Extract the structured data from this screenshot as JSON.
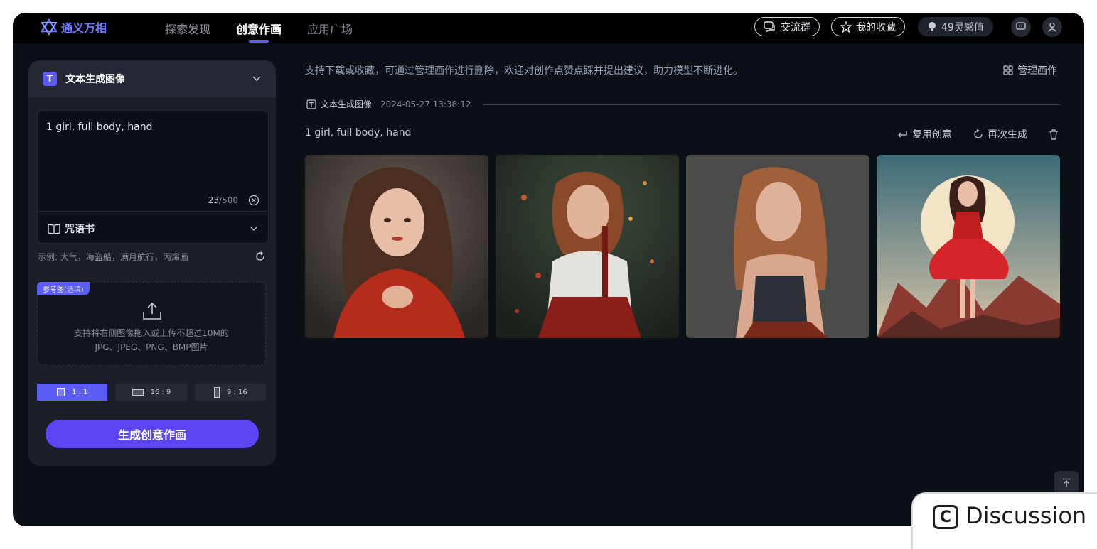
{
  "app": {
    "name": "通义万相"
  },
  "nav": {
    "items": [
      "探索发现",
      "创意作画",
      "应用广场"
    ],
    "active": "创意作画"
  },
  "header": {
    "group_label": "交流群",
    "favorites_label": "我的收藏",
    "credits_label": "49灵感值"
  },
  "panel": {
    "title": "文本生成图像",
    "prompt": "1 girl, full body, hand",
    "count": "23",
    "max": "/500",
    "spellbook_label": "咒语书",
    "examples": "示例:  大气，海盗船，满月航行，丙烯画",
    "ref_tag": "参考图",
    "ref_optional": "(选填)",
    "upload_line1": "支持将右侧图像拖入或上传不超过10M的",
    "upload_line2": "JPG、JPEG、PNG、BMP图片",
    "ratios": [
      "1 : 1",
      "16 : 9",
      "9 : 16"
    ],
    "active_ratio": "1 : 1",
    "generate_label": "生成创意作画"
  },
  "main": {
    "notice": "支持下载或收藏，可通过管理画作进行删除，欢迎对创作点赞点踩并提出建议，助力模型不断进化。",
    "manage_label": "管理画作",
    "record_type": "文本生成图像",
    "record_time": "2024-05-27 13:38:12",
    "record_prompt": "1 girl, full body, hand",
    "reuse_label": "复用创意",
    "regenerate_label": "再次生成"
  },
  "footer": {
    "discussion_label": "Discussion"
  },
  "colors": {
    "accent": "#5b5cf6",
    "background": "#0b0f16",
    "panel": "#1b1f28"
  }
}
